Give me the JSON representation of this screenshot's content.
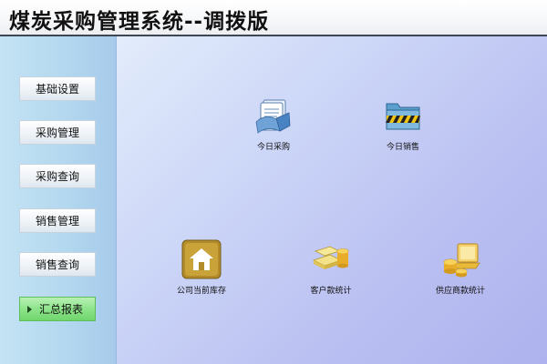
{
  "app": {
    "title": "煤炭采购管理系统--调拨版"
  },
  "sidebar": {
    "items": [
      {
        "label": "基础设置",
        "active": false
      },
      {
        "label": "采购管理",
        "active": false
      },
      {
        "label": "采购查询",
        "active": false
      },
      {
        "label": "销售管理",
        "active": false
      },
      {
        "label": "销售查询",
        "active": false
      },
      {
        "label": "汇总报表",
        "active": true
      }
    ]
  },
  "main": {
    "tiles": [
      {
        "label": "今日采购",
        "icon": "document-icon"
      },
      {
        "label": "今日销售",
        "icon": "folder-icon"
      },
      {
        "label": "公司当前库存",
        "icon": "warehouse-icon"
      },
      {
        "label": "客户款统计",
        "icon": "money-stack-icon"
      },
      {
        "label": "供应商款统计",
        "icon": "coins-laptop-icon"
      }
    ]
  },
  "colors": {
    "accent_active": "#8ee48b",
    "sidebar_bg": "#b4d8ef",
    "main_bg": "#c4ccf4",
    "title_border": "#3e4653"
  }
}
